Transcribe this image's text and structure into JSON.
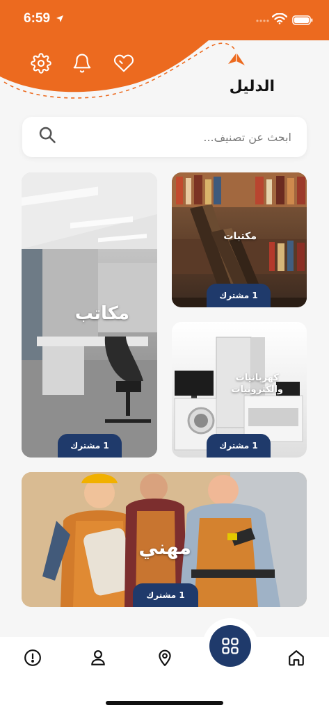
{
  "status_bar": {
    "time": "6:59"
  },
  "header": {
    "title": "الدليل"
  },
  "search": {
    "placeholder": "ابحث عن تصنيف..."
  },
  "categories": [
    {
      "label": "مكتبات",
      "badge": "1 مشترك"
    },
    {
      "label": "مكاتب",
      "badge": "1 مشترك"
    },
    {
      "label": "كهربانيات\nوالكترونيات",
      "badge": "1 مشترك"
    },
    {
      "label": "مهني",
      "badge": "1 مشترك"
    }
  ],
  "colors": {
    "accent": "#ec6a1f",
    "navy": "#1f3a6b",
    "background": "#f6f6f6"
  },
  "icons": {
    "header": [
      "gear-icon",
      "bell-icon",
      "heart-icon"
    ],
    "nav": [
      "alert-icon",
      "user-icon",
      "location-pin-icon",
      "grid-icon",
      "home-icon"
    ]
  }
}
